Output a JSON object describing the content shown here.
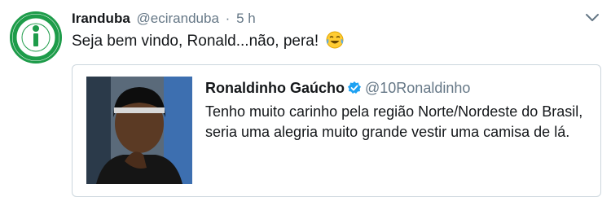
{
  "tweet": {
    "author_name": "Iranduba",
    "author_handle": "@eciranduba",
    "separator": "·",
    "time": "5 h",
    "text": "Seja bem vindo, Ronald...não, pera!",
    "emoji": "face-with-tears-of-joy-icon"
  },
  "quoted_tweet": {
    "author_name": "Ronaldinho Gaúcho",
    "verified": true,
    "author_handle": "@10Ronaldinho",
    "text": "Tenho muito carinho pela região Norte/Nordeste do Brasil, seria uma alegria muito grande vestir uma camisa de lá."
  },
  "colors": {
    "name_text": "#14171a",
    "secondary_text": "#657786",
    "verified_blue": "#1da1f2",
    "logo_green": "#1e9c4a",
    "card_border": "#ccd6dd"
  },
  "icons": [
    "chevron-down-icon",
    "verified-badge-icon",
    "face-with-tears-of-joy-icon"
  ]
}
